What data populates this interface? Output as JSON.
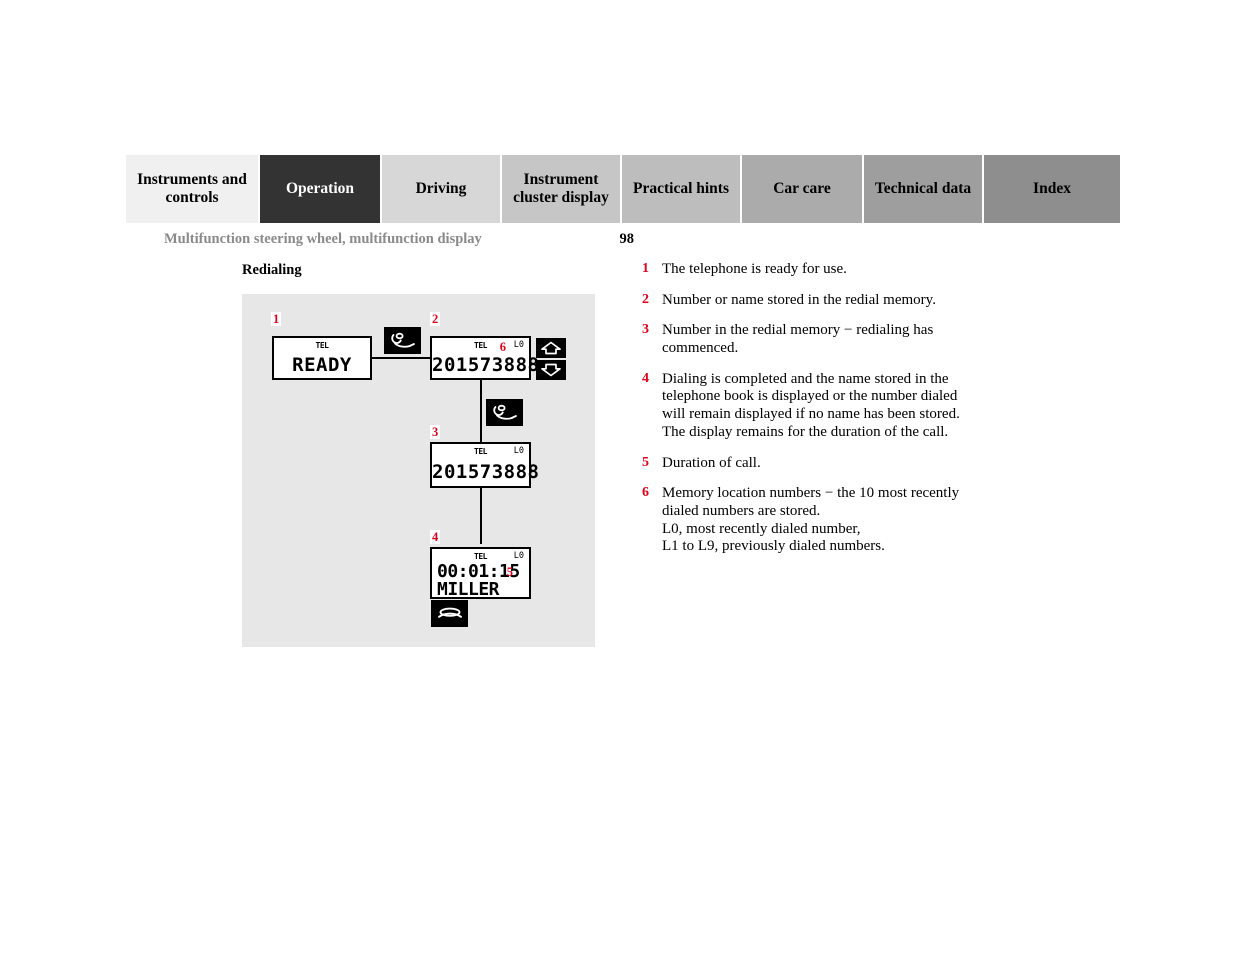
{
  "tabs": [
    {
      "label": "Instruments and controls",
      "bg": "#f0f0f0",
      "active": false
    },
    {
      "label": "Operation",
      "bg": "#333333",
      "active": true
    },
    {
      "label": "Driving",
      "bg": "#d7d7d7",
      "active": false
    },
    {
      "label": "Instrument cluster display",
      "bg": "#c6c6c6",
      "active": false
    },
    {
      "label": "Practical hints",
      "bg": "#bdbdbd",
      "active": false
    },
    {
      "label": "Car care",
      "bg": "#ababab",
      "active": false
    },
    {
      "label": "Technical data",
      "bg": "#9e9e9e",
      "active": false
    },
    {
      "label": "Index",
      "bg": "#8e8e8e",
      "active": false
    }
  ],
  "header": {
    "breadcrumb": "Multifunction steering wheel, multifunction display",
    "page_number": "98"
  },
  "section": {
    "heading": "Redialing"
  },
  "diagram": {
    "displays": [
      {
        "callout": "1",
        "tel_label": "TEL",
        "memory_label": "",
        "main_text": "READY",
        "second_text": "",
        "inner_callout": ""
      },
      {
        "callout": "2",
        "tel_label": "TEL",
        "memory_label": "L0",
        "main_text": "201573888",
        "second_text": "",
        "inner_callout": "6"
      },
      {
        "callout": "3",
        "tel_label": "TEL",
        "memory_label": "L0",
        "main_text": "201573888",
        "second_text": "",
        "inner_callout": ""
      },
      {
        "callout": "4",
        "tel_label": "TEL",
        "memory_label": "L0",
        "main_text": "00:01:15",
        "second_text": "MILLER",
        "inner_callout": "5"
      }
    ],
    "icons": {
      "pickup_1": "phone-offhook-icon",
      "pickup_2": "phone-offhook-icon",
      "hangup": "phone-onhook-icon",
      "scroll_up": "arrow-up-icon",
      "scroll_down": "arrow-down-icon"
    }
  },
  "notes": [
    {
      "num": "1",
      "lines": [
        "The telephone is ready for use."
      ]
    },
    {
      "num": "2",
      "lines": [
        "Number or name stored in the redial memory."
      ]
    },
    {
      "num": "3",
      "lines": [
        "Number in the redial memory − redialing has",
        "commenced."
      ]
    },
    {
      "num": "4",
      "lines": [
        "Dialing is completed and the name stored in the",
        "telephone book is displayed or the number dialed",
        "will remain displayed if no name has been stored.",
        "The display remains for the duration of the call."
      ]
    },
    {
      "num": "5",
      "lines": [
        "Duration of call."
      ]
    },
    {
      "num": "6",
      "lines": [
        "Memory location numbers − the 10 most recently",
        "dialed numbers are stored.",
        "L0, most recently dialed number,",
        "L1 to L9, previously dialed numbers."
      ]
    }
  ],
  "colors": {
    "accent_red": "#e3001b",
    "panel_gray": "#e7e7e7",
    "breadcrumb_gray": "#8a8a8a"
  }
}
